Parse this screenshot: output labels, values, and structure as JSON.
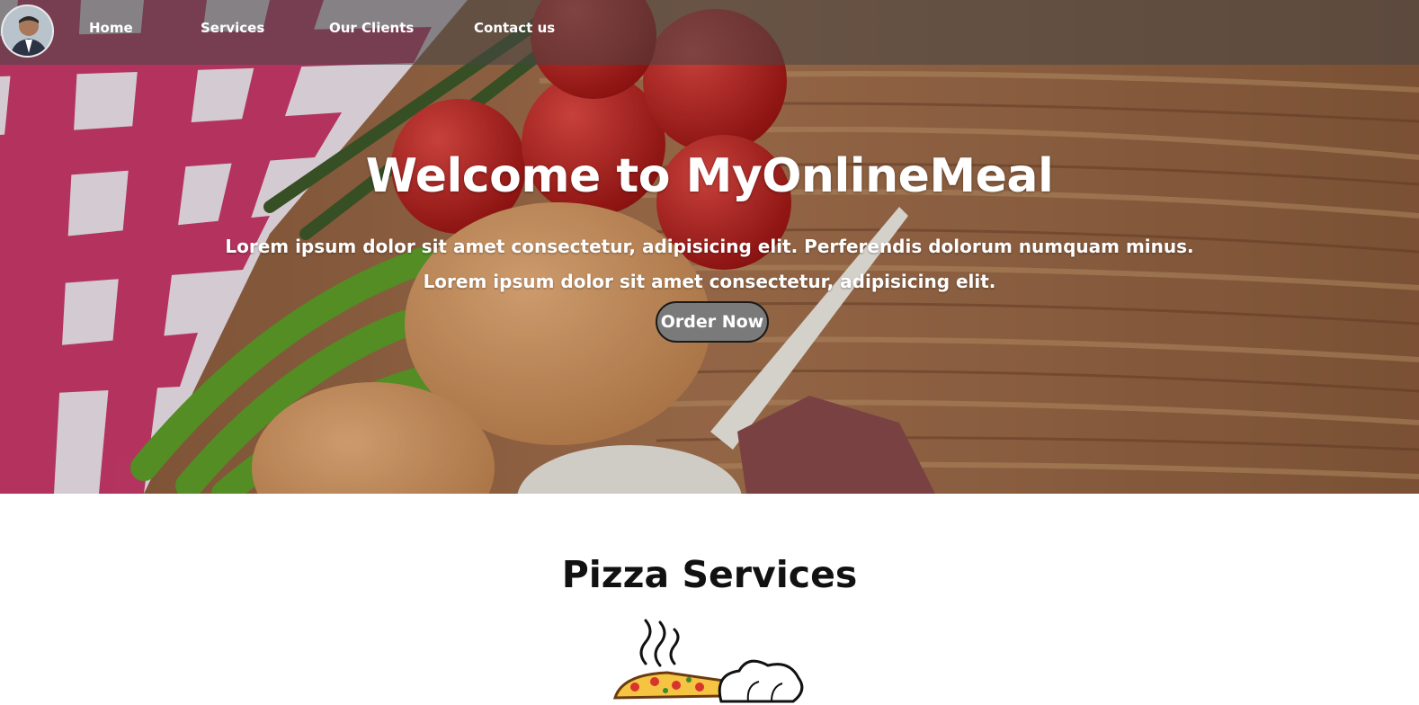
{
  "nav": {
    "avatar_icon": "avatar",
    "items": [
      {
        "label": "Home"
      },
      {
        "label": "Services"
      },
      {
        "label": "Our Clients"
      },
      {
        "label": "Contact us"
      }
    ]
  },
  "hero": {
    "title": "Welcome to MyOnlineMeal",
    "line1": "Lorem ipsum dolor sit amet consectetur, adipisicing elit. Perferendis dolorum numquam minus.",
    "line2": "Lorem ipsum dolor sit amet consectetur, adipisicing elit.",
    "button_label": "Order Now"
  },
  "services": {
    "title": "Pizza Services",
    "illustration_icon": "pizza-chef-illustration"
  },
  "colors": {
    "nav_bg": "#464646",
    "button_bg": "#7a7a7a",
    "text_light": "#ffffff",
    "heading_dark": "#111111"
  }
}
